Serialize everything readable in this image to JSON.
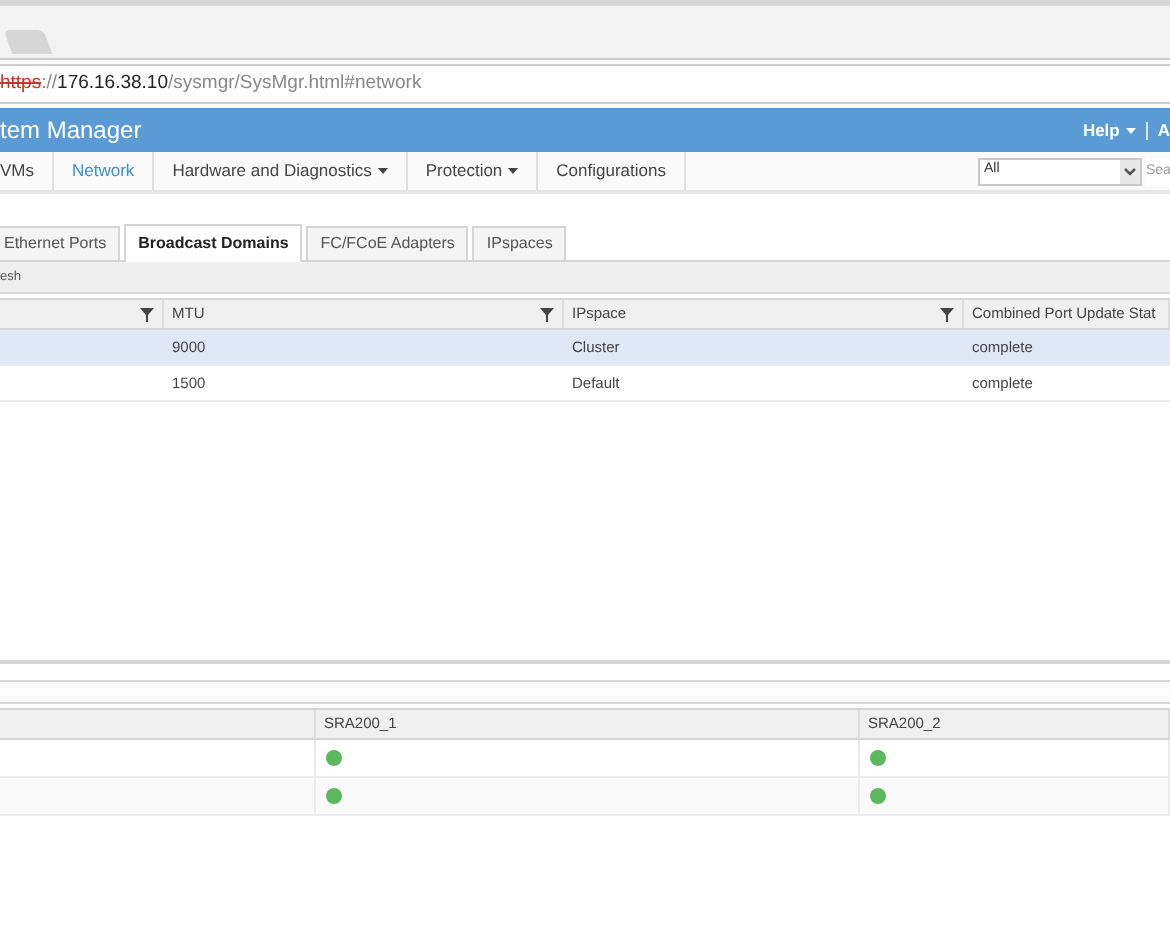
{
  "address": {
    "scheme": "https",
    "separator": "://",
    "host": "176.16.38.10",
    "path": "/sysmgr/SysMgr.html#network"
  },
  "header": {
    "title": "tem Manager",
    "help": "Help",
    "user": "A"
  },
  "nav": [
    {
      "label": "VMs",
      "selected": false,
      "dropdown": false
    },
    {
      "label": "Network",
      "selected": true,
      "dropdown": false
    },
    {
      "label": "Hardware and Diagnostics",
      "selected": false,
      "dropdown": true
    },
    {
      "label": "Protection",
      "selected": false,
      "dropdown": true
    },
    {
      "label": "Configurations",
      "selected": false,
      "dropdown": false
    }
  ],
  "filter": {
    "value": "All"
  },
  "search": {
    "placeholder": "Sea"
  },
  "tabs": [
    {
      "label": "Ethernet Ports",
      "selected": false
    },
    {
      "label": "Broadcast Domains",
      "selected": true
    },
    {
      "label": "FC/FCoE Adapters",
      "selected": false
    },
    {
      "label": "IPspaces",
      "selected": false
    }
  ],
  "toolbar": {
    "refresh": "esh"
  },
  "table": {
    "columns": [
      {
        "filter": true
      },
      {
        "label": "MTU",
        "filter": true
      },
      {
        "label": "IPspace",
        "filter": true
      },
      {
        "label": "Combined Port Update Stat",
        "filter": false
      }
    ],
    "rows": [
      {
        "selected": true,
        "cells": [
          "",
          "9000",
          "Cluster",
          "complete"
        ]
      },
      {
        "selected": false,
        "cells": [
          "",
          "1500",
          "Default",
          "complete"
        ]
      }
    ]
  },
  "nodes_table": {
    "columns": [
      "",
      "SRA200_1",
      "SRA200_2"
    ],
    "rows": [
      {
        "status": [
          {
            "online": true
          },
          {
            "online": true
          }
        ]
      },
      {
        "status": [
          {
            "online": true
          },
          {
            "online": true
          }
        ]
      }
    ]
  }
}
